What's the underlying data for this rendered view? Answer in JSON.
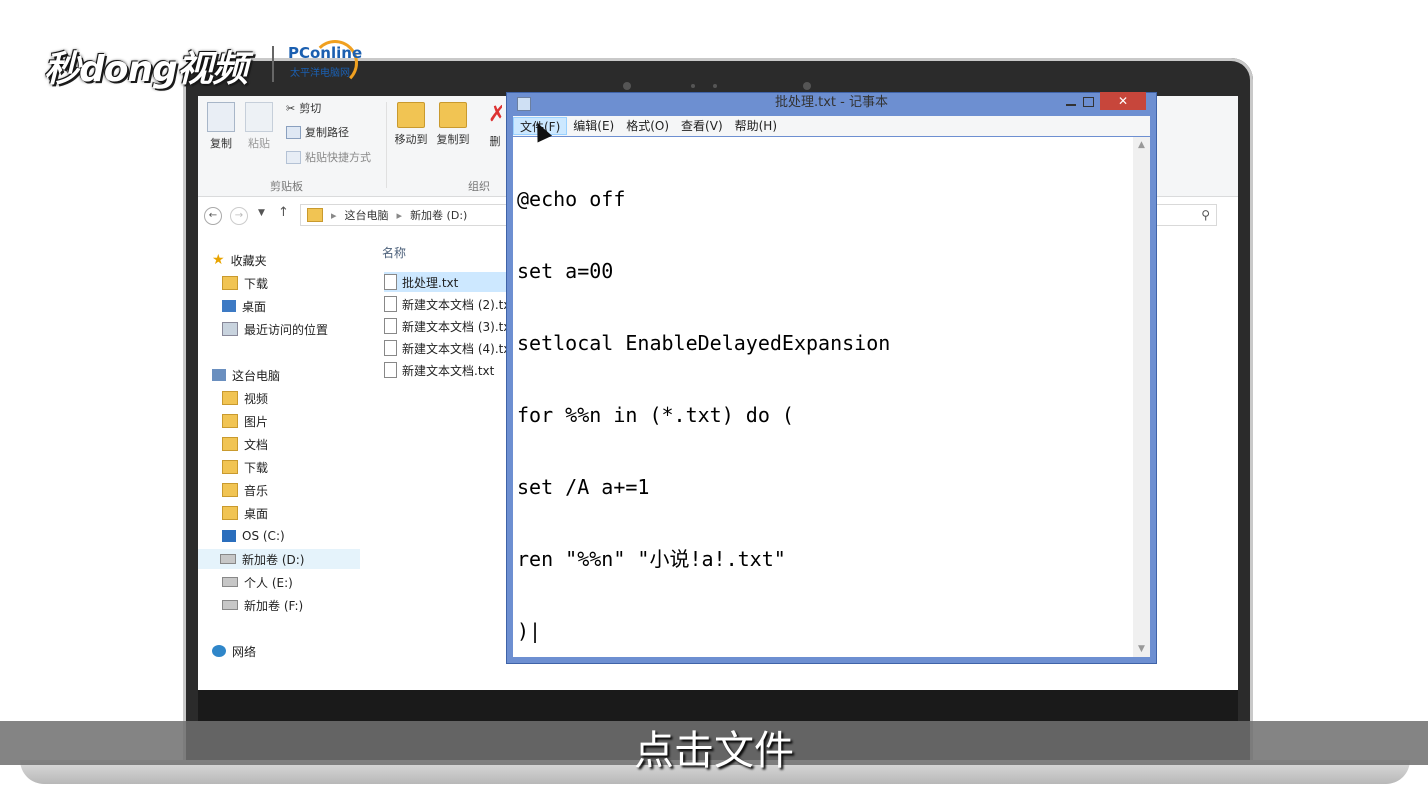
{
  "watermark": {
    "logo_text": "秒dong视频",
    "partner_text": "PConline",
    "partner_sub": "太平洋电脑网"
  },
  "ribbon": {
    "copy": "复制",
    "paste": "粘贴",
    "cut": "剪切",
    "copy_path": "复制路径",
    "paste_shortcut": "粘贴快捷方式",
    "move_to": "移动到",
    "copy_to": "复制到",
    "delete_partial": "删",
    "group_clipboard": "剪贴板",
    "group_organize": "组织"
  },
  "address": {
    "back": "←",
    "forward": "→",
    "up": "↑",
    "path": [
      "这台电脑",
      "新加卷 (D:)"
    ]
  },
  "nav": {
    "favorites": "收藏夹",
    "downloads": "下载",
    "desktop": "桌面",
    "recent": "最近访问的位置",
    "this_pc": "这台电脑",
    "videos": "视频",
    "pictures": "图片",
    "documents": "文档",
    "downloads2": "下载",
    "music": "音乐",
    "desktop2": "桌面",
    "os_c": "OS (C:)",
    "vol_d": "新加卷 (D:)",
    "personal_e": "个人 (E:)",
    "vol_f": "新加卷 (F:)",
    "network": "网络"
  },
  "files": {
    "header_name": "名称",
    "items": [
      "批处理.txt",
      "新建文本文档 (2).txt",
      "新建文本文档 (3).txt",
      "新建文本文档 (4).txt",
      "新建文本文档.txt"
    ]
  },
  "notepad": {
    "title": "批处理.txt - 记事本",
    "close": "✕",
    "menus": [
      "文件(F)",
      "编辑(E)",
      "格式(O)",
      "查看(V)",
      "帮助(H)"
    ],
    "code_lines": [
      "@echo off",
      "set a=00",
      "setlocal EnableDelayedExpansion",
      "for %%n in (*.txt) do (",
      "set /A a+=1",
      "ren \"%%n\" \"小说!a!.txt\"",
      ")|"
    ]
  },
  "subtitle": "点击文件"
}
